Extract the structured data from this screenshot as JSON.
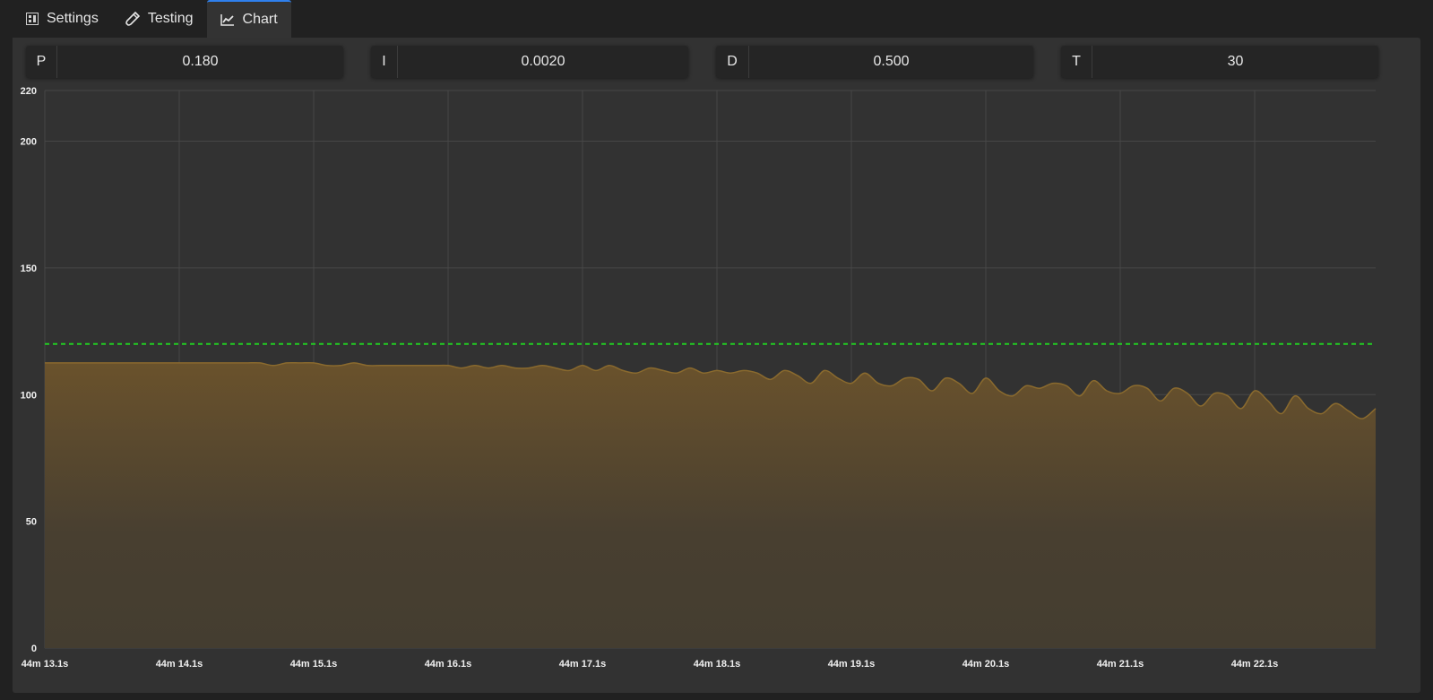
{
  "tabs": [
    {
      "label": "Settings",
      "icon": "settings-icon"
    },
    {
      "label": "Testing",
      "icon": "test-tube-icon"
    },
    {
      "label": "Chart",
      "icon": "line-chart-icon",
      "active": true
    }
  ],
  "params": [
    {
      "key": "P",
      "value": "0.180"
    },
    {
      "key": "I",
      "value": "0.0020"
    },
    {
      "key": "D",
      "value": "0.500"
    },
    {
      "key": "T",
      "value": "30"
    }
  ],
  "chart_data": {
    "type": "area",
    "title": "",
    "xlabel": "",
    "ylabel": "",
    "ylim": [
      0,
      220
    ],
    "yticks": [
      0,
      50,
      100,
      150,
      200,
      220
    ],
    "xticks": [
      "44m 13.1s",
      "44m 14.1s",
      "44m 15.1s",
      "44m 16.1s",
      "44m 17.1s",
      "44m 18.1s",
      "44m 19.1s",
      "44m 20.1s",
      "44m 21.1s",
      "44m 22.1s"
    ],
    "xlim": [
      13.1,
      23.0
    ],
    "grid": true,
    "setpoint": {
      "value": 120,
      "color": "#22cc22",
      "style": "dashed"
    },
    "series": [
      {
        "color": "#8a6a2e",
        "x": [
          13.1,
          13.3,
          13.5,
          13.7,
          13.9,
          14.1,
          14.3,
          14.5,
          14.6,
          14.7,
          14.8,
          14.9,
          15.0,
          15.1,
          15.2,
          15.3,
          15.4,
          15.5,
          15.6,
          15.7,
          15.8,
          15.9,
          16.0,
          16.1,
          16.2,
          16.3,
          16.4,
          16.5,
          16.6,
          16.7,
          16.8,
          16.9,
          17.0,
          17.1,
          17.2,
          17.3,
          17.4,
          17.5,
          17.6,
          17.7,
          17.8,
          17.9,
          18.0,
          18.1,
          18.2,
          18.3,
          18.4,
          18.5,
          18.6,
          18.7,
          18.8,
          18.9,
          19.0,
          19.1,
          19.2,
          19.3,
          19.4,
          19.5,
          19.6,
          19.7,
          19.8,
          19.9,
          20.0,
          20.1,
          20.2,
          20.3,
          20.4,
          20.5,
          20.6,
          20.7,
          20.8,
          20.9,
          21.0,
          21.1,
          21.2,
          21.3,
          21.4,
          21.5,
          21.6,
          21.7,
          21.8,
          21.9,
          22.0,
          22.1,
          22.2,
          22.3,
          22.4,
          22.5,
          22.6,
          22.7,
          22.8,
          22.9,
          23.0
        ],
        "values": [
          112.5,
          112.5,
          112.5,
          112.5,
          112.5,
          112.5,
          112.5,
          112.5,
          112.5,
          112.5,
          111.5,
          112.5,
          112.5,
          112.5,
          111.5,
          111.5,
          112.5,
          111.5,
          111.5,
          111.5,
          111.5,
          111.5,
          111.5,
          111.5,
          110.5,
          111.5,
          110.5,
          111.5,
          110.5,
          110.5,
          111.5,
          110.5,
          109.5,
          111.5,
          109.5,
          111.5,
          109.5,
          108.5,
          110.5,
          109.5,
          108.5,
          110.5,
          108.5,
          109.5,
          108.5,
          109.5,
          108.5,
          106.0,
          109.5,
          107.5,
          104.5,
          109.5,
          106.5,
          104.5,
          108.5,
          104.5,
          103.5,
          106.5,
          106.0,
          101.5,
          106.5,
          104.5,
          100.5,
          106.5,
          101.5,
          99.5,
          103.5,
          102.5,
          104.5,
          103.5,
          99.5,
          105.5,
          101.5,
          100.5,
          103.5,
          102.5,
          97.5,
          102.5,
          100.5,
          95.5,
          100.5,
          99.5,
          94.5,
          101.5,
          97.5,
          92.5,
          99.5,
          94.5,
          92.5,
          96.5,
          93.5,
          90.5,
          94.5
        ]
      }
    ]
  }
}
